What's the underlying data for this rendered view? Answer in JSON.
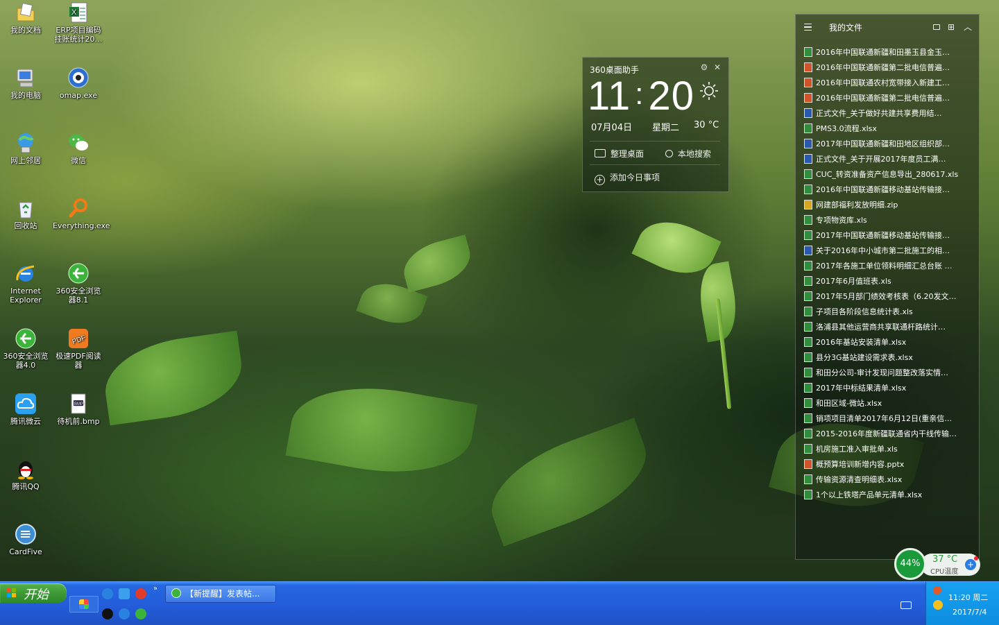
{
  "desktop_icons": [
    {
      "label": "我的文档",
      "icon": "my-documents-icon"
    },
    {
      "label": "ERP项目编码挂账统计20…",
      "icon": "excel-file-icon"
    },
    {
      "label": "我的电脑",
      "icon": "my-computer-icon"
    },
    {
      "label": "omap.exe",
      "icon": "omap-exe-icon"
    },
    {
      "label": "网上邻居",
      "icon": "network-places-icon"
    },
    {
      "label": "微信",
      "icon": "wechat-icon"
    },
    {
      "label": "回收站",
      "icon": "recycle-bin-icon"
    },
    {
      "label": "Everything.exe",
      "icon": "everything-search-icon"
    },
    {
      "label": "Internet Explorer",
      "icon": "internet-explorer-icon"
    },
    {
      "label": "360安全浏览器8.1",
      "icon": "360-browser-icon"
    },
    {
      "label": "360安全浏览器4.0",
      "icon": "360-browser-icon"
    },
    {
      "label": "极速PDF阅读器",
      "icon": "pdf-reader-icon"
    },
    {
      "label": "腾讯微云",
      "icon": "weiyun-cloud-icon"
    },
    {
      "label": "待机前.bmp",
      "icon": "bmp-file-icon"
    },
    {
      "label": "腾讯QQ",
      "icon": "qq-penguin-icon"
    },
    {
      "label": "CardFive",
      "icon": "cardfive-icon"
    }
  ],
  "helper": {
    "title": "360桌面助手",
    "time_h": "11",
    "time_m": "20",
    "date": "07月04日",
    "weekday": "星期二",
    "temp": "30 °C",
    "organize": "整理桌面",
    "search": "本地搜索",
    "add_todo": "添加今日事项"
  },
  "files": {
    "title": "我的文件",
    "items": [
      {
        "name": "2016年中国联通新疆和田墨玉县金玉…",
        "type": "x"
      },
      {
        "name": "2016年中国联通新疆第二批电信普遍…",
        "type": "p"
      },
      {
        "name": "2016年中国联通农村宽带接入新建工…",
        "type": "p"
      },
      {
        "name": "2016年中国联通新疆第二批电信普遍…",
        "type": "p"
      },
      {
        "name": "正式文件_关于做好共建共享费用结…",
        "type": "w"
      },
      {
        "name": "PMS3.0流程.xlsx",
        "type": "x"
      },
      {
        "name": "2017年中国联通新疆和田地区组织部…",
        "type": "w"
      },
      {
        "name": "正式文件_关于开展2017年度员工满…",
        "type": "w"
      },
      {
        "name": "CUC_转资准备资产信息导出_280617.xls",
        "type": "x"
      },
      {
        "name": "2016年中国联通新疆移动基站传输接…",
        "type": "x"
      },
      {
        "name": "网建部福利发放明细.zip",
        "type": "z"
      },
      {
        "name": "专项物资库.xls",
        "type": "x"
      },
      {
        "name": "2017年中国联通新疆移动基站传输接…",
        "type": "x"
      },
      {
        "name": "关于2016年中小城市第二批施工的相…",
        "type": "w"
      },
      {
        "name": "2017年各施工单位领料明细汇总台账 …",
        "type": "x"
      },
      {
        "name": "2017年6月值班表.xls",
        "type": "x"
      },
      {
        "name": "2017年5月部门绩效考核表（6.20发文…",
        "type": "x"
      },
      {
        "name": "子项目各阶段信息统计表.xls",
        "type": "x"
      },
      {
        "name": "洛浦县其他运营商共享联通杆路统计…",
        "type": "x"
      },
      {
        "name": "2016年基站安装清单.xlsx",
        "type": "x"
      },
      {
        "name": "县分3G基站建设需求表.xlsx",
        "type": "x"
      },
      {
        "name": "和田分公司-审计发现问题整改落实情…",
        "type": "x"
      },
      {
        "name": "2017年中标结果清单.xlsx",
        "type": "x"
      },
      {
        "name": "和田区域-微站.xlsx",
        "type": "x"
      },
      {
        "name": "销项项目清单2017年6月12日(重亲信…",
        "type": "x"
      },
      {
        "name": "2015-2016年度新疆联通省内干线传输…",
        "type": "x"
      },
      {
        "name": "机房施工准入审批单.xls",
        "type": "x"
      },
      {
        "name": "概预算培训新增内容.pptx",
        "type": "p"
      },
      {
        "name": "传输资源清查明细表.xlsx",
        "type": "x"
      },
      {
        "name": "1个以上铁塔产品单元清单.xlsx",
        "type": "x"
      }
    ]
  },
  "cpu": {
    "percent": "44%",
    "temp": "37 °C",
    "label": "CPU温度"
  },
  "taskbar": {
    "start_label": "开始",
    "task_label": "【新提醒】发表帖...",
    "clock_time": "11:20 周二",
    "clock_date": "2017/7/4"
  },
  "colors": {
    "taskbar": "#245edb",
    "start": "#3d9a35",
    "tray": "#0d8ee0"
  }
}
